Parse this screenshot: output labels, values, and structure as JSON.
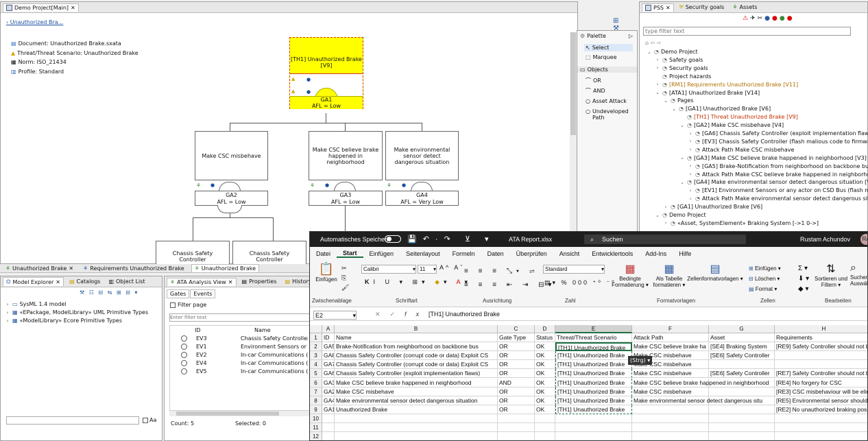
{
  "editor": {
    "tab": "Demo Project[Main]",
    "breadcrumb": "Unauthorized Bra...",
    "info": [
      "Document: Unauthorized Brake.sxata",
      "Threat/Threat Scenario: Unauthorized Brake",
      "Norm: ISO_21434",
      "Profile: Standard"
    ],
    "root_node": "[TH1] Unauthorized Brake\n[V9]",
    "ga1_id": "GA1",
    "ga1_afl": "AFL = Low",
    "node_ga2": "Make CSC misbehave",
    "node_ga3": "Make CSC believe brake happened in neighborhood",
    "node_ga4": "Make environmental sensor detect dangerous situation",
    "ga2_id": "GA2",
    "ga2_afl": "AFL = Low",
    "ga3_id": "GA3",
    "ga3_afl": "AFL = Low",
    "ga4_id": "GA4",
    "ga4_afl": "AFL = Very Low",
    "leaf1": "Chassis Safety Controller",
    "leaf2": "Chassis Safety Controller"
  },
  "palette": {
    "title": "Palette",
    "select": "Select",
    "marquee": "Marquee",
    "objects": "Objects",
    "items": [
      "OR",
      "AND",
      "Asset Attack",
      "Undeveloped Path"
    ]
  },
  "bottom_tabs": [
    "Unauthorized Brake",
    "Requirements Unauthorized Brake",
    "Unauthorized Brake"
  ],
  "model_explorer": {
    "tabs": [
      "Model Explorer",
      "Catalogs",
      "Object List"
    ],
    "items": [
      "SysML 1.4 model",
      "«EPackage, ModelLibrary» UML Primitive Types",
      "«ModelLibrary» Ecore Primitive Types"
    ]
  },
  "ata_view": {
    "tabs": [
      "ATA Analysis View",
      "Properties",
      "History"
    ],
    "subtabs": [
      "Gates",
      "Events"
    ],
    "filter_page": "Filter page",
    "filter_placeholder": "Enter filter text",
    "cols": [
      "ID",
      "Name"
    ],
    "rows": [
      [
        "EV3",
        "Chassis Safety Controller (fla"
      ],
      [
        "EV1",
        "Environment Sensors or any a"
      ],
      [
        "EV2",
        "In-car Communications (liste"
      ],
      [
        "EV4",
        "In-car Communications (liste"
      ],
      [
        "EV5",
        "In-car Communications (liste"
      ]
    ],
    "count": "Count: 5",
    "selected": "Selected: 0"
  },
  "pss": {
    "tabs": [
      "PSS",
      "Security goals",
      "Assets"
    ],
    "filter_placeholder": "type filter text",
    "tree": [
      {
        "d": 0,
        "t": "Demo Project",
        "c": "#111",
        "x": "v"
      },
      {
        "d": 1,
        "t": "Safety goals",
        "c": "#111",
        "x": ">"
      },
      {
        "d": 1,
        "t": "Security goals",
        "c": "#111",
        "x": ">"
      },
      {
        "d": 1,
        "t": "Project hazards",
        "c": "#111",
        "x": ""
      },
      {
        "d": 1,
        "t": "[RM1] Requirements Unauthorized Brake [V11]",
        "c": "#b07000",
        "x": ">"
      },
      {
        "d": 1,
        "t": "[ATA1] Unauthorized Brake [V14]",
        "c": "#111",
        "x": "v"
      },
      {
        "d": 2,
        "t": "Pages",
        "c": "#111",
        "x": "v"
      },
      {
        "d": 3,
        "t": "[GA1] Unauthorized Brake [V6]",
        "c": "#111",
        "x": "v"
      },
      {
        "d": 4,
        "t": "[TH1] Threat Unauthorized Brake [V9]",
        "c": "#c03000",
        "x": ""
      },
      {
        "d": 4,
        "t": "[GA2] Make CSC misbehave [V4]",
        "c": "#111",
        "x": "v"
      },
      {
        "d": 5,
        "t": "[GA6] Chassis Safety Controller (exploit implementation flaws) [V7]",
        "c": "#111",
        "x": ">"
      },
      {
        "d": 5,
        "t": "[EV3] Chassis Safety Controller (flash malious code to firmware) [V4]",
        "c": "#111",
        "x": ">"
      },
      {
        "d": 5,
        "t": "Attack Path Make CSC misbehave",
        "c": "#111",
        "x": ">"
      },
      {
        "d": 4,
        "t": "[GA3] Make CSC believe brake happened in neighborhood [V3]",
        "c": "#111",
        "x": "v"
      },
      {
        "d": 5,
        "t": "[GA5] Brake-Notification from neighborhood on backbone bus [V5]",
        "c": "#111",
        "x": ">"
      },
      {
        "d": 5,
        "t": "Attack Path Make CSC believe brake happened in neighborhood",
        "c": "#111",
        "x": ">"
      },
      {
        "d": 4,
        "t": "[GA4] Make environmental sensor detect dangerous situation [V3]",
        "c": "#111",
        "x": "v"
      },
      {
        "d": 5,
        "t": "[EV1] Environment Sensors or any actor on CSD Bus (flash malicious",
        "c": "#111",
        "x": ">"
      },
      {
        "d": 5,
        "t": "Attack Path Make environmental sensor detect dangerous situation",
        "c": "#111",
        "x": ">"
      },
      {
        "d": 2,
        "t": "[GA1] Unauthorized Brake [V6]",
        "c": "#111",
        "x": ">"
      },
      {
        "d": 1,
        "t": "Demo Project",
        "c": "#111",
        "x": "v"
      },
      {
        "d": 2,
        "t": "«Asset, SystemElement» Braking System [->1 0->]",
        "c": "#111",
        "x": ">"
      }
    ]
  },
  "excel": {
    "autosave": "Automatisches Speichern",
    "filename": "ATA Report.xlsx",
    "search": "Suchen",
    "user": "Rustam Achundov",
    "user_initials": "RA",
    "menu": [
      "Datei",
      "Start",
      "Einfügen",
      "Seitenlayout",
      "Formeln",
      "Daten",
      "Überprüfen",
      "Ansicht",
      "Entwicklertools",
      "Add-Ins",
      "Hilfe"
    ],
    "font": "Calibri",
    "size": "11",
    "numfmt": "Standard",
    "groups": [
      "Zwischenablage",
      "Schriftart",
      "Ausrichtung",
      "Zahl",
      "Formatvorlagen",
      "Zellen",
      "Bearbeiten"
    ],
    "btns": {
      "paste": "Einfügen",
      "cond": "Bedingte Formatierung",
      "astable": "Als Tabelle formatieren",
      "cellstyles": "Zellenformatvorlagen",
      "insert": "Einfügen",
      "delete": "Löschen",
      "format": "Format",
      "sort": "Sortieren und Filtern",
      "find": "Suchen und Auswählen"
    },
    "namebox": "E2",
    "formula": "[TH1] Unauthorized Brake",
    "paste_tag": "(Strg)",
    "cols": [
      "A",
      "B",
      "C",
      "D",
      "E",
      "F",
      "G",
      "H"
    ],
    "rows": [
      [
        "ID",
        "Name",
        "Gate Type",
        "Status",
        "Threat/Threat Scenario",
        "Attack Path",
        "Asset",
        "Requirements"
      ],
      [
        "GA5",
        "Brake-Notification from neighborhood on backbone bus",
        "OR",
        "OK",
        "[TH1] Unauthorized Brake",
        "Make CSC believe brake ha",
        "[SE4] Braking System",
        "[RE9] Safety Controller should not b"
      ],
      [
        "GA8",
        "Chassis Safety Controller (corrupt code or data) Exploit CS",
        "OR",
        "OK",
        "[TH1] Unauthorized Brake",
        "Make CSC misbehave",
        "[SE6] Safety Controller",
        ""
      ],
      [
        "GA7",
        "Chassis Safety Controller (corrupt code or data) Exploit CS",
        "OR",
        "OK",
        "[TH1] Unauthorized Brake",
        "Make CSC misbehave",
        "",
        ""
      ],
      [
        "GA6",
        "Chassis Safety Controller (exploit implementation flaws)",
        "OR",
        "OK",
        "[TH1] Unauthorized Brake",
        "Make CSC misbehave",
        "[SE6] Safety Controller",
        "[RE7] Safety Controller should not b"
      ],
      [
        "GA3",
        "Make CSC believe brake happened in neighborhood",
        "AND",
        "OK",
        "[TH1] Unauthorized Brake",
        "Make CSC believe brake happened in neighborhood",
        "",
        "[RE4] No forgery for CSC"
      ],
      [
        "GA2",
        "Make CSC misbehave",
        "OR",
        "OK",
        "[TH1] Unauthorized Brake",
        "Make CSC misbehave",
        "",
        "[RE3] CSC misbehaviour will be elim"
      ],
      [
        "GA4",
        "Make environmental sensor detect dangerous situation",
        "OR",
        "OK",
        "[TH1] Unauthorized Brake",
        "Make environmental sensor detect dangerous situ",
        "",
        "[RE5] Environmental sensor should"
      ],
      [
        "GA1",
        "Unauthorized Brake",
        "OR",
        "OK",
        "[TH1] Unauthorized Brake",
        "",
        "",
        "[RE2] No unauthorized braking poss"
      ],
      [
        "",
        "",
        "",
        "",
        "",
        "",
        "",
        ""
      ],
      [
        "",
        "",
        "",
        "",
        "",
        "",
        "",
        ""
      ],
      [
        "",
        "",
        "",
        "",
        "",
        "",
        "",
        ""
      ]
    ]
  }
}
